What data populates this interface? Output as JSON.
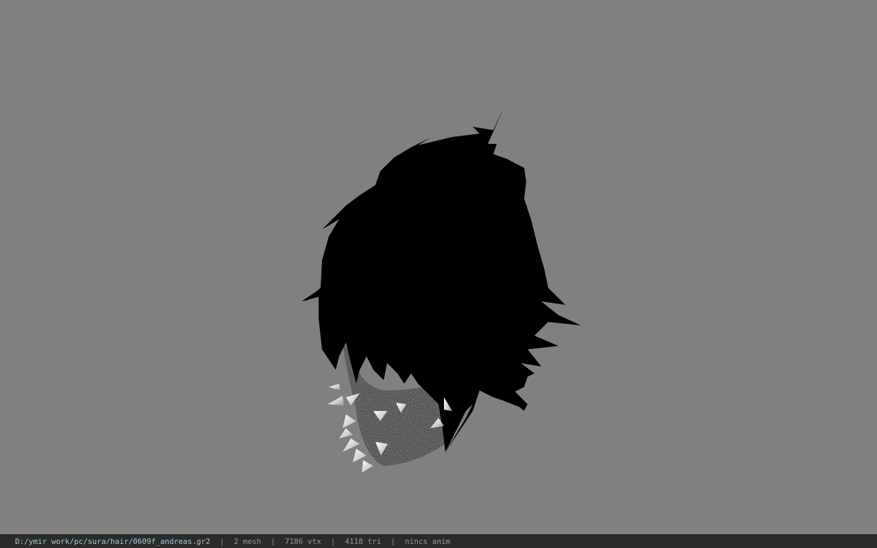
{
  "viewport": {
    "background_color": "#808080",
    "model": {
      "hair_color": "#000000",
      "mask_color": "#3a3a3a",
      "spike_color": "#d8d8d8"
    }
  },
  "statusbar": {
    "file_path": "D:/ymir work/pc/sura/hair/0609f_andreas.gr2",
    "separator": "|",
    "mesh_count": "2 mesh",
    "vertex_count": "7186 vtx",
    "triangle_count": "4118 tri",
    "anim_status": "nincs anim"
  }
}
